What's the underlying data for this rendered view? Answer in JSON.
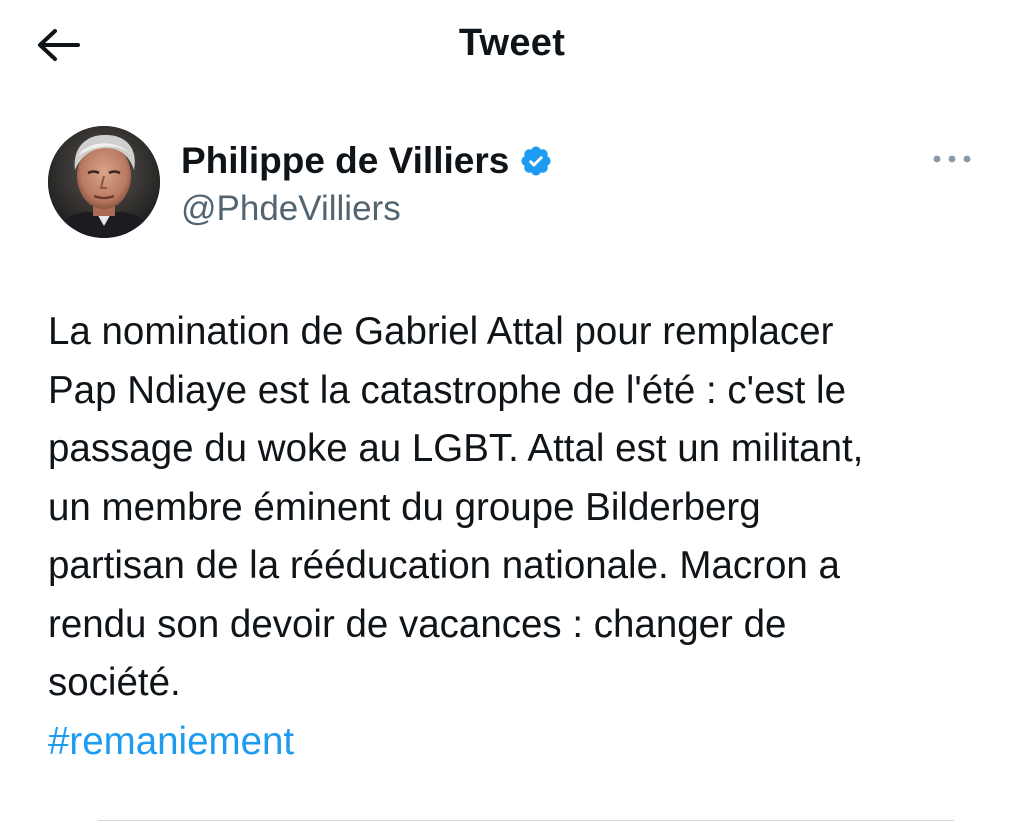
{
  "header": {
    "title": "Tweet",
    "back_icon": "arrow-left-icon"
  },
  "author": {
    "display_name": "Philippe de Villiers",
    "handle": "@PhdeVilliers",
    "verified_icon": "verified-badge-icon",
    "avatar_icon": "avatar-photo",
    "more_icon": "more-horizontal-icon"
  },
  "tweet": {
    "body": "La nomination de Gabriel Attal pour remplacer\nPap Ndiaye est la catastrophe de l'été : c'est le\npassage du woke au LGBT. Attal est un militant,\nun membre éminent du groupe Bilderberg\npartisan de la rééducation nationale. Macron a\nrendu son devoir de vacances : changer de\nsociété.",
    "hashtag": "#remaniement"
  },
  "colors": {
    "text": "#0f1419",
    "secondary": "#536471",
    "link": "#1d9bf0",
    "verified": "#1d9bf0",
    "divider": "#cfd9de"
  }
}
